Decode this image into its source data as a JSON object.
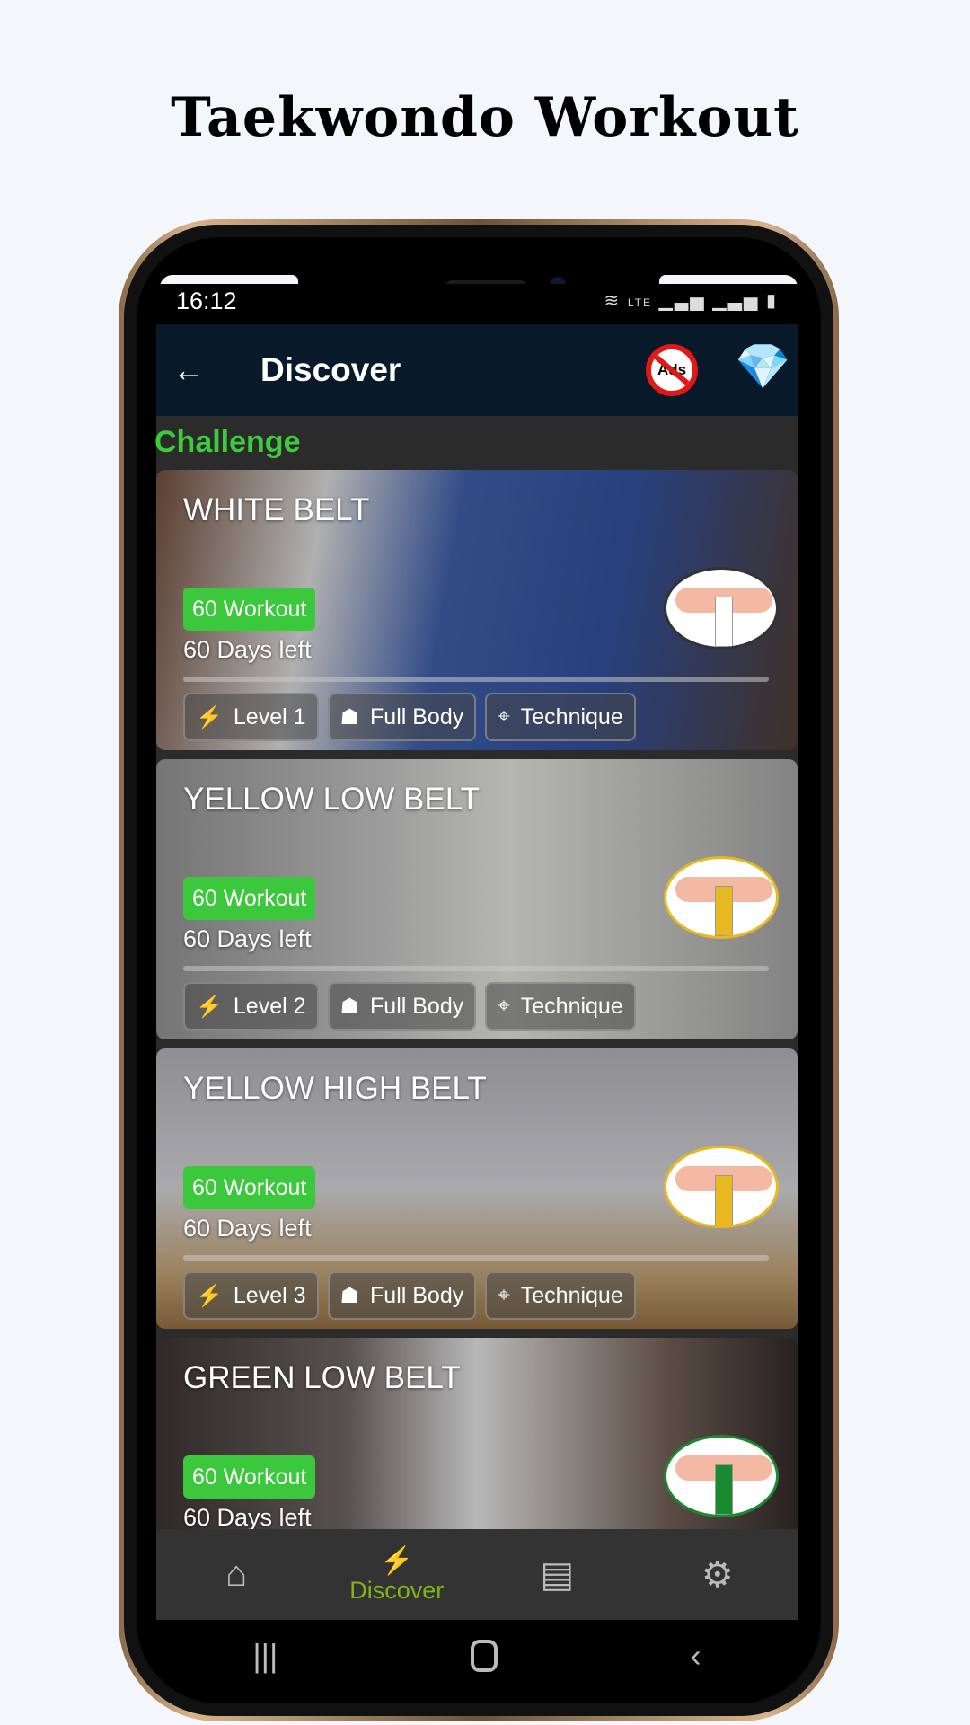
{
  "headline": "Taekwondo Workout",
  "status": {
    "time": "16:12",
    "icons": "wifi-icon lte-icon signal-icon signal-icon battery-icon"
  },
  "appbar": {
    "title": "Discover",
    "no_ads_label": "Ads",
    "back_icon": "arrow-left-icon",
    "premium_icon": "diamond-icon"
  },
  "section": {
    "title": "Challenge"
  },
  "colors": {
    "accent": "#3cc83c",
    "nav_active": "#7cb518",
    "appbar": "#081a2a"
  },
  "cards": [
    {
      "title": "WHITE BELT",
      "badge": "60 Workout",
      "days": "60 Days left",
      "progress": 0,
      "belt_color": "#ffffff",
      "bg": "linear-gradient(100deg,#6b4a3a 0%,#cfcfcf 25%,#3c5aa0 45%,#2f4c94 70%,#4a3a30 100%)",
      "chips": [
        "Level 1",
        "Full Body",
        "Technique"
      ]
    },
    {
      "title": "YELLOW LOW BELT",
      "badge": "60 Workout",
      "days": "60 Days left",
      "progress": 0,
      "belt_color": "#e8b820",
      "bg": "linear-gradient(90deg,#8a8a8a 0%,#b8b8b8 35%,#d6d6d0 55%,#9a9a9a 100%)",
      "chips": [
        "Level 2",
        "Full Body",
        "Technique"
      ]
    },
    {
      "title": "YELLOW HIGH BELT",
      "badge": "60 Workout",
      "days": "60 Days left",
      "progress": 0,
      "belt_color": "#e8b820",
      "bg": "linear-gradient(180deg,#a8a8ac 0%,#c8c8cc 50%,#b89a70 80%,#8c6a40 100%)",
      "chips": [
        "Level 3",
        "Full Body",
        "Technique"
      ]
    },
    {
      "title": "GREEN LOW BELT",
      "badge": "60 Workout",
      "days": "60 Days left",
      "progress": 0,
      "belt_color": "#1a8a30",
      "bg": "linear-gradient(90deg,#3a3030 0%,#6a6060 30%,#d8d8d8 50%,#6a5a50 80%,#302828 100%)",
      "chips": []
    }
  ],
  "chip_icons": [
    "lightning-icon",
    "body-icon",
    "target-icon"
  ],
  "bottom_nav": [
    {
      "label": "",
      "icon": "home-icon"
    },
    {
      "label": "Discover",
      "icon": "lightning-icon",
      "active": true
    },
    {
      "label": "",
      "icon": "calendar-icon"
    },
    {
      "label": "",
      "icon": "gear-icon"
    }
  ]
}
